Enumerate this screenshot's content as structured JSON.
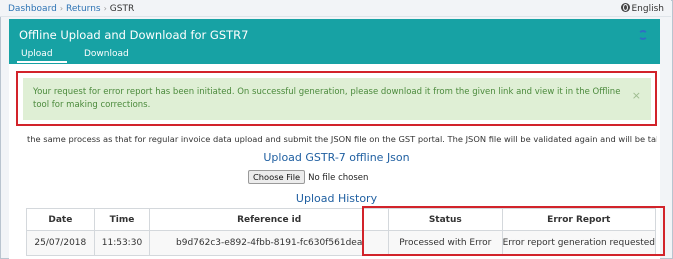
{
  "breadcrumb": {
    "items": [
      "Dashboard",
      "Returns"
    ],
    "current": "GSTR",
    "separator": "›"
  },
  "language": "English",
  "header": {
    "title": "Offline Upload and Download for GSTR7",
    "tabs": [
      {
        "label": "Upload",
        "active": true
      },
      {
        "label": "Download",
        "active": false
      }
    ]
  },
  "alert": {
    "message": "Your request for error report has been initiated. On successful generation, please download it from the given link and view it in the Offline tool for making corrections.",
    "close": "×"
  },
  "note": "the same process as that for regular invoice data upload and submit the JSON file on the GST portal. The JSON file will be validated again and will be taker",
  "upload": {
    "title": "Upload GSTR-7 offline Json",
    "choose_button": "Choose File",
    "file_status": "No file chosen"
  },
  "history": {
    "title": "Upload History",
    "columns": [
      "Date",
      "Time",
      "Reference id",
      "Status",
      "Error Report"
    ],
    "rows": [
      [
        "25/07/2018",
        "11:53:30",
        "b9d762c3-e892-4fbb-8191-fc630f561dea",
        "Processed with Error",
        "Error report generation requested"
      ]
    ]
  },
  "colors": {
    "header_bg": "#17a2a4",
    "alert_bg": "#dfefd5",
    "alert_text": "#4b8a3c",
    "highlight": "#d2232a",
    "link": "#2e74b5"
  }
}
